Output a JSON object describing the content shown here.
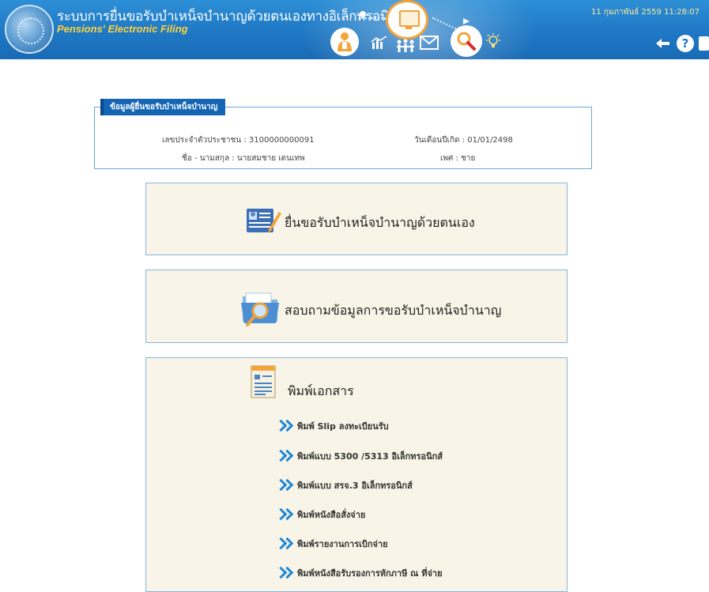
{
  "header": {
    "title_th": "ระบบการยื่นขอรับบำเหน็จบำนาญด้วยตนเองทางอิเล็กทรอนิกส์",
    "title_en": "Pensions' Electronic Filing",
    "datetime": "11 กุมภาพันธ์ 2559 11:28:07",
    "icons": [
      "person-icon",
      "chart-icon",
      "monitor-icon",
      "family-icon",
      "mail-icon",
      "search-icon",
      "lightbulb-icon",
      "back-arrow-icon",
      "help-icon"
    ]
  },
  "info": {
    "legend": "ข้อมูลผู้ยื่นขอรับบำเหน็จบำนาญ",
    "id_label": "เลขประจำตัวประชาชน : 3100000000091",
    "name_label": "ชื่อ - นามสกุล : นายสมชาย เดนเทพ",
    "dob_label": "วันเดือนปีเกิด : 01/01/2498",
    "gender_label": "เพศ : ชาย"
  },
  "menu": {
    "file_pension": "ยื่นขอรับบำเหน็จบำนาญด้วยตนเอง",
    "inquiry": "สอบถามข้อมูลการขอรับบำเหน็จบำนาญ",
    "print_docs": "พิมพ์เอกสาร",
    "print_items": [
      "พิมพ์ Slip ลงทะเบียนรับ",
      "พิมพ์แบบ 5300 /5313 อิเล็กทรอนิกส์",
      "พิมพ์แบบ สรจ.3 อิเล็กทรอนิกส์",
      "พิมพ์หนังสือสั่งจ่าย",
      "พิมพ์รายงานการเบิกจ่าย",
      "พิมพ์หนังสือรับรองการหักภาษี ณ ที่จ่าย"
    ]
  },
  "colors": {
    "header_blue": "#1f78c4",
    "accent_orange": "#f3a43a",
    "legend_blue": "#1565b5",
    "panel_bg": "#f8f4e7",
    "chevron_blue": "#1e88d8"
  }
}
